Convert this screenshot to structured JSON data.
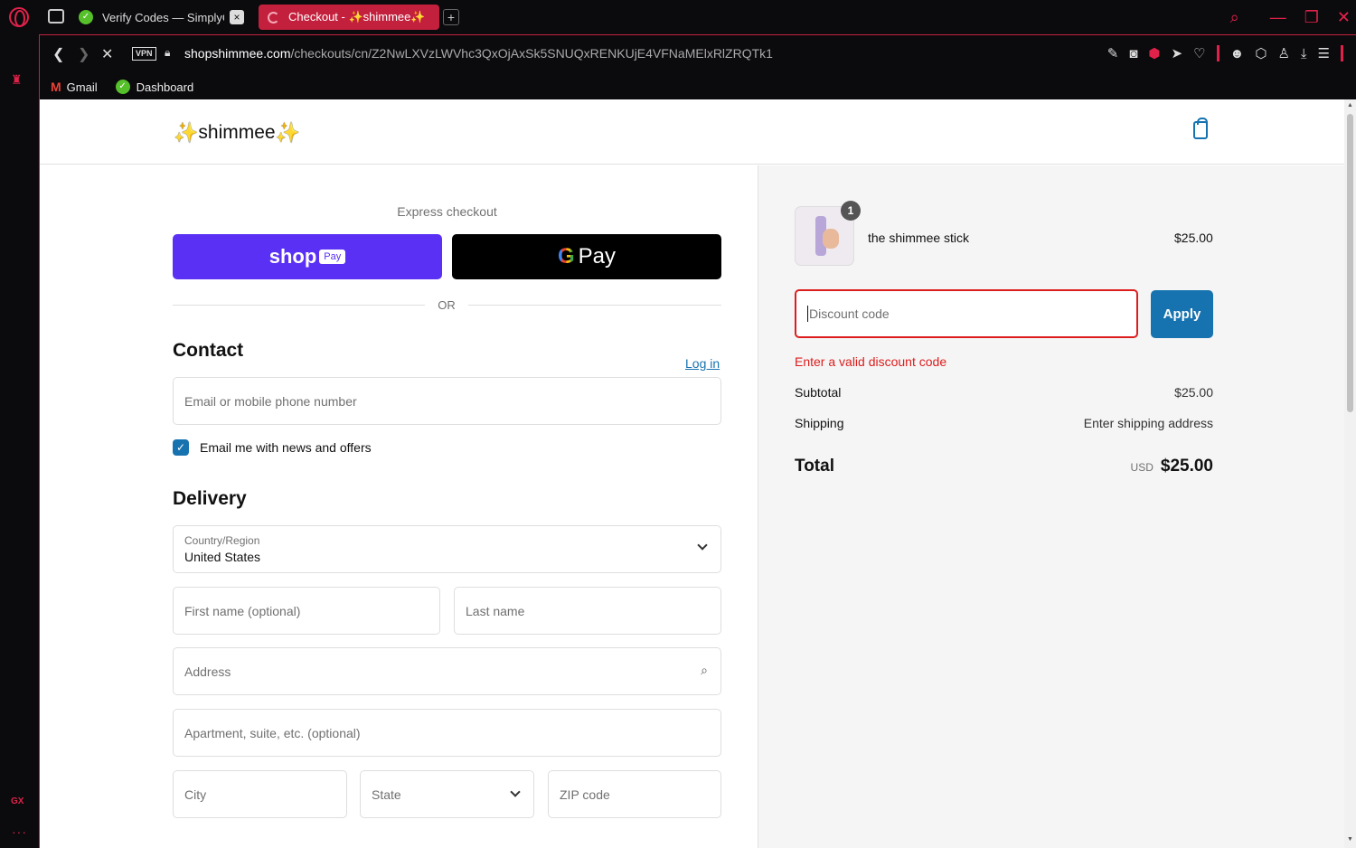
{
  "browser": {
    "tabs": [
      {
        "title": "Verify Codes — SimplyCodes",
        "close": "×"
      },
      {
        "title": "Checkout - ✨shimmee✨"
      }
    ],
    "new_tab": "+",
    "vpn_label": "VPN",
    "url_domain": "shopshimmee.com",
    "url_path": "/checkouts/cn/Z2NwLXVzLWVhc3QxOjAxSk5SNUQxRENKUjE4VFNaMElxRlZRQTk1",
    "bookmarks": [
      {
        "label": "Gmail"
      },
      {
        "label": "Dashboard"
      }
    ],
    "sidebar_gx": "GX",
    "sidebar_more": "···"
  },
  "store": {
    "name": "shimmee",
    "spark": "✨"
  },
  "checkout": {
    "express_label": "Express checkout",
    "shop_pay": {
      "shop": "shop",
      "pay": "Pay"
    },
    "gpay": {
      "g": "G",
      "pay": "Pay"
    },
    "or_label": "OR",
    "contact": {
      "heading": "Contact",
      "login_link": "Log in",
      "email_placeholder": "Email or mobile phone number",
      "news_checkbox_label": "Email me with news and offers",
      "news_checked": true
    },
    "delivery": {
      "heading": "Delivery",
      "country_label": "Country/Region",
      "country_value": "United States",
      "first_name_placeholder": "First name (optional)",
      "last_name_placeholder": "Last name",
      "address_placeholder": "Address",
      "apartment_placeholder": "Apartment, suite, etc. (optional)",
      "city_placeholder": "City",
      "state_placeholder": "State",
      "zip_placeholder": "ZIP code"
    }
  },
  "summary": {
    "item": {
      "name": "the shimmee stick",
      "price": "$25.00",
      "quantity": "1"
    },
    "discount_placeholder": "Discount code",
    "apply_label": "Apply",
    "error": "Enter a valid discount code",
    "subtotal_label": "Subtotal",
    "subtotal_value": "$25.00",
    "shipping_label": "Shipping",
    "shipping_value": "Enter shipping address",
    "total_label": "Total",
    "total_currency": "USD",
    "total_value": "$25.00"
  },
  "colors": {
    "accent": "#1773b0",
    "error": "#dd1d1d",
    "shop_pay": "#5a31f4",
    "browser_accent": "#e0224a"
  }
}
